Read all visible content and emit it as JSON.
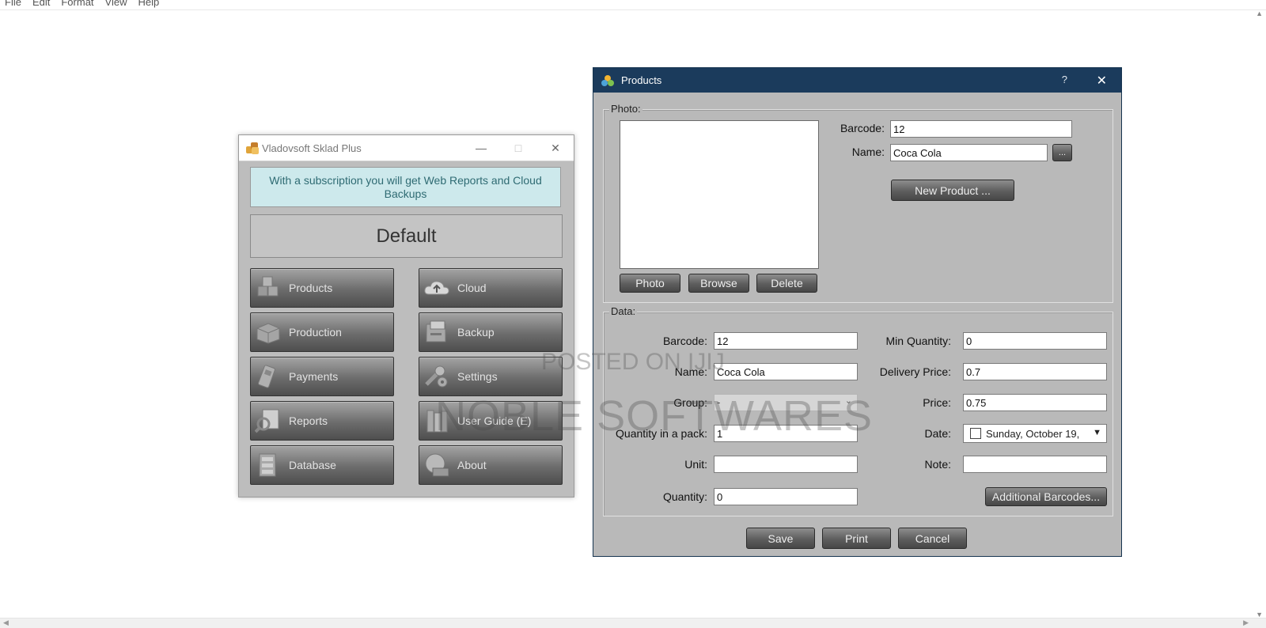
{
  "menu": {
    "items": [
      "File",
      "Edit",
      "Format",
      "View",
      "Help"
    ]
  },
  "sklad": {
    "title": "Vladovsoft Sklad Plus",
    "banner": "With a subscription you will get Web Reports and Cloud Backups",
    "profile": "Default",
    "tiles": [
      {
        "label": "Products",
        "icon": "boxes-icon"
      },
      {
        "label": "Cloud",
        "icon": "cloud-icon"
      },
      {
        "label": "Production",
        "icon": "production-icon"
      },
      {
        "label": "Backup",
        "icon": "backup-icon"
      },
      {
        "label": "Payments",
        "icon": "payments-icon"
      },
      {
        "label": "Settings",
        "icon": "settings-icon"
      },
      {
        "label": "Reports",
        "icon": "reports-icon"
      },
      {
        "label": "User Guide (E)",
        "icon": "book-icon"
      },
      {
        "label": "Database",
        "icon": "database-icon"
      },
      {
        "label": "About",
        "icon": "about-icon"
      }
    ]
  },
  "products": {
    "title": "Products",
    "help": "?",
    "photo_group": "Photo:",
    "data_group": "Data:",
    "top": {
      "barcode_label": "Barcode:",
      "barcode_value": "12",
      "name_label": "Name:",
      "name_value": "Coca Cola",
      "browse_name_button": "...",
      "new_product_button": "New Product ..."
    },
    "photo_buttons": {
      "photo": "Photo",
      "browse": "Browse",
      "delete": "Delete"
    },
    "fields": {
      "barcode_label": "Barcode:",
      "barcode_value": "12",
      "name_label": "Name:",
      "name_value": "Coca Cola",
      "group_label": "Group:",
      "group_value": "-",
      "qty_pack_label": "Quantity in a pack:",
      "qty_pack_value": "1",
      "unit_label": "Unit:",
      "unit_value": "",
      "quantity_label": "Quantity:",
      "quantity_value": "0",
      "min_qty_label": "Min Quantity:",
      "min_qty_value": "0",
      "delivery_price_label": "Delivery Price:",
      "delivery_price_value": "0.7",
      "price_label": "Price:",
      "price_value": "0.75",
      "date_label": "Date:",
      "date_value": "Sunday, October 19,",
      "note_label": "Note:",
      "note_value": ""
    },
    "additional_barcodes_button": "Additional Barcodes...",
    "buttons": {
      "save": "Save",
      "print": "Print",
      "cancel": "Cancel"
    }
  },
  "watermarks": {
    "line1": "POSTED ON IJIJ",
    "line2": "NOBLE SOFTWARES"
  }
}
